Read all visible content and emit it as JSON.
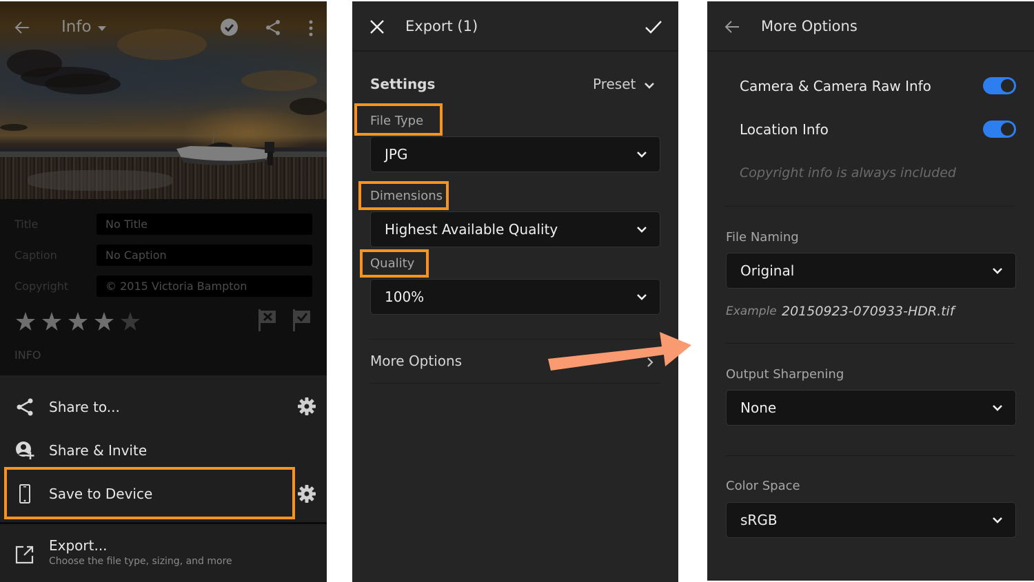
{
  "colors": {
    "highlight": "#f7931e",
    "arrow": "#f99a70",
    "toggle_on": "#2d7ff0",
    "panel_bg": "#252525"
  },
  "panel_info": {
    "topbar": {
      "back_icon": "arrow-left-icon",
      "title": "Info",
      "title_caret_icon": "caret-down-icon",
      "pick_icon": "check-circle-icon",
      "share_icon": "share-icon",
      "more_icon": "more-vertical-icon"
    },
    "metadata": [
      {
        "label": "Title",
        "value": "No Title"
      },
      {
        "label": "Caption",
        "value": "No Caption"
      },
      {
        "label": "Copyright",
        "value": "© 2015 Victoria Bampton"
      }
    ],
    "rating": {
      "value": 4,
      "max": 5
    },
    "flags": {
      "reject_icon": "flag-reject-icon",
      "pick_icon": "flag-pick-icon"
    },
    "section_tag": "INFO",
    "menu": [
      {
        "label": "Share to...",
        "icon": "share-icon",
        "has_settings": true
      },
      {
        "label": "Share & Invite",
        "icon": "add-user-icon",
        "has_settings": false
      },
      {
        "label": "Save to Device",
        "icon": "phone-icon",
        "has_settings": true,
        "highlighted": true
      },
      {
        "label": "Export...",
        "icon": "export-icon",
        "subtitle": "Choose the file type, sizing, and more",
        "has_settings": false
      }
    ]
  },
  "panel_export": {
    "title": "Export (1)",
    "close_icon": "close-icon",
    "confirm_icon": "checkmark-icon",
    "settings_title": "Settings",
    "preset_label": "Preset",
    "fields": [
      {
        "label": "File Type",
        "value": "JPG",
        "highlighted": true
      },
      {
        "label": "Dimensions",
        "value": "Highest Available Quality",
        "highlighted": true
      },
      {
        "label": "Quality",
        "value": "100%",
        "highlighted": true
      }
    ],
    "more_options_label": "More Options"
  },
  "panel_more": {
    "title": "More Options",
    "back_icon": "arrow-left-icon",
    "toggles": [
      {
        "label": "Camera & Camera Raw Info",
        "on": true
      },
      {
        "label": "Location Info",
        "on": true
      }
    ],
    "note": "Copyright info is always included",
    "file_naming": {
      "label": "File Naming",
      "value": "Original"
    },
    "example": {
      "label": "Example",
      "value": "20150923-070933-HDR.tif"
    },
    "output_sharpening": {
      "label": "Output Sharpening",
      "value": "None"
    },
    "color_space": {
      "label": "Color Space",
      "value": "sRGB"
    }
  }
}
